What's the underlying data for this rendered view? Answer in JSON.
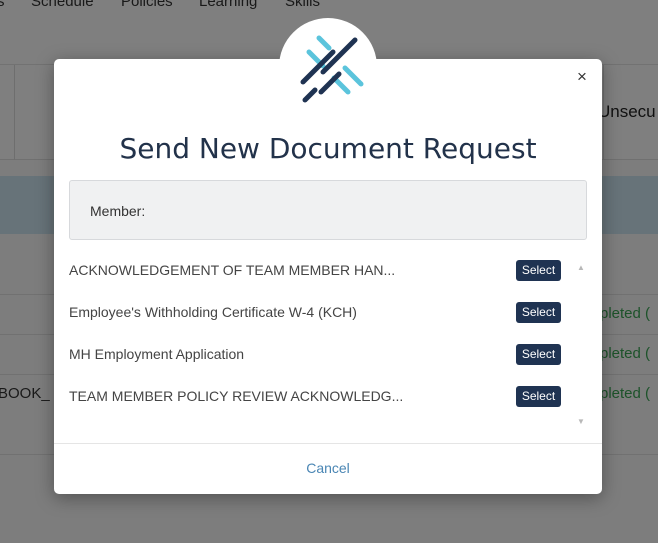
{
  "background": {
    "nav_items": [
      "s",
      "Schedule",
      "Policies",
      "Learning",
      "Skills"
    ],
    "header_column_fragment": "Unsecu",
    "left_fragment": "BOOK_",
    "status_fragments": [
      "pleted (",
      "pleted (",
      "pleted ("
    ]
  },
  "modal": {
    "close_label": "×",
    "title": "Send New Document Request",
    "member_label": "Member:",
    "documents": [
      {
        "label": "ACKNOWLEDGEMENT OF TEAM MEMBER HAN...",
        "button": "Select"
      },
      {
        "label": "Employee's Withholding Certificate W-4 (KCH)",
        "button": "Select"
      },
      {
        "label": "MH Employment Application",
        "button": "Select"
      },
      {
        "label": "TEAM MEMBER POLICY REVIEW ACKNOWLEDG...",
        "button": "Select"
      }
    ],
    "cancel_label": "Cancel"
  },
  "colors": {
    "brand_navy": "#1f3352",
    "brand_teal": "#5bc4dc",
    "link_blue": "#4a86b4"
  },
  "icons": {
    "logo": "stripes-logo-icon",
    "scroll_up": "triangle-up-icon",
    "scroll_down": "triangle-down-icon"
  }
}
